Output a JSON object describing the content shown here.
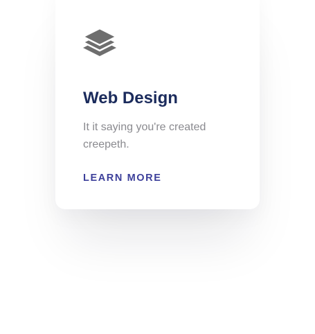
{
  "card": {
    "icon": "layers-icon",
    "title": "Web Design",
    "description": "It it saying you're created creepeth.",
    "link_label": "LEARN MORE",
    "colors": {
      "title": "#1b2b5c",
      "description": "#8a8a8f",
      "link": "#3c3f9a",
      "icon": "#6e6e6e"
    }
  }
}
